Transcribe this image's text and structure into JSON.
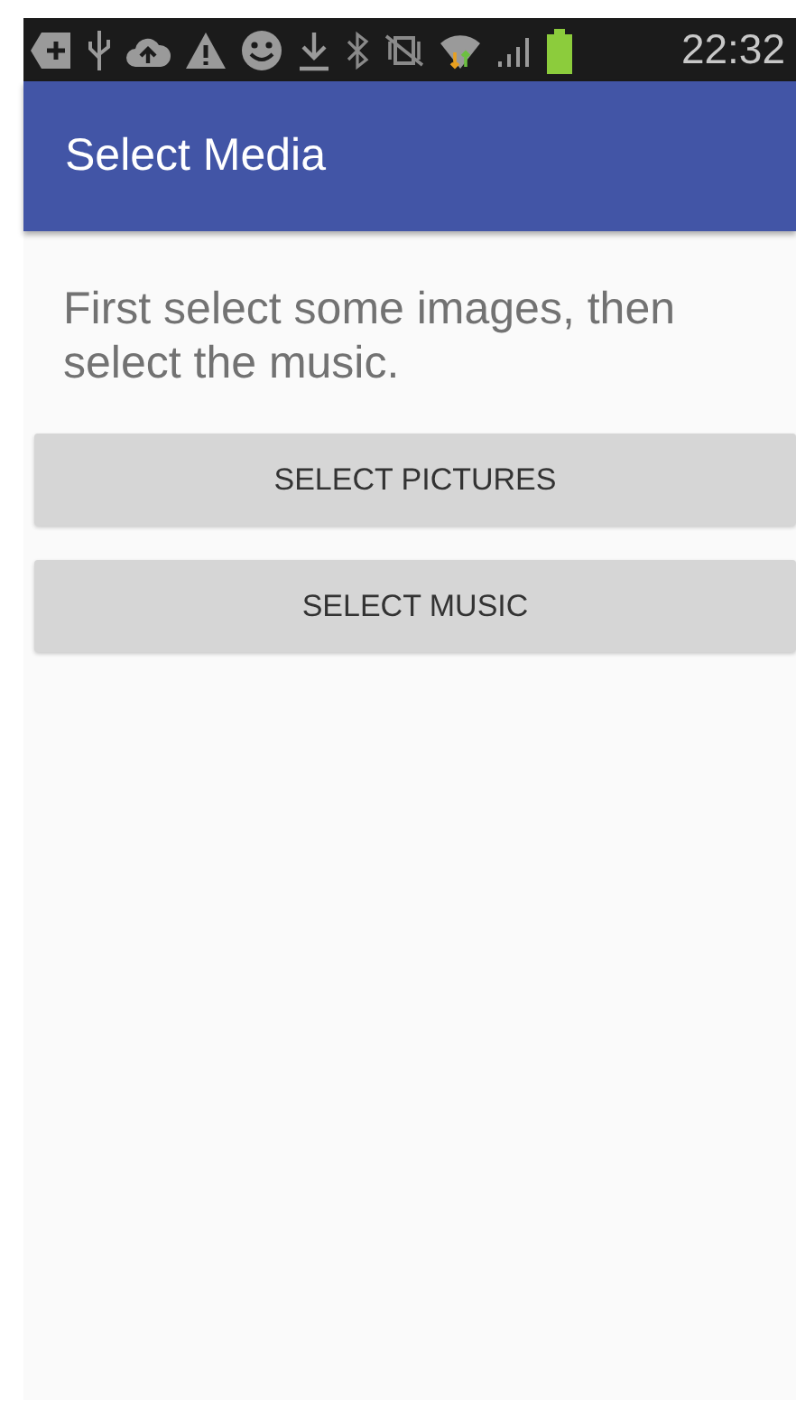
{
  "status_bar": {
    "time": "22:32"
  },
  "app_bar": {
    "title": "Select Media"
  },
  "instruction": "First select some images, then select the music.",
  "buttons": [
    {
      "label": "SELECT PICTURES"
    },
    {
      "label": "SELECT MUSIC"
    }
  ]
}
